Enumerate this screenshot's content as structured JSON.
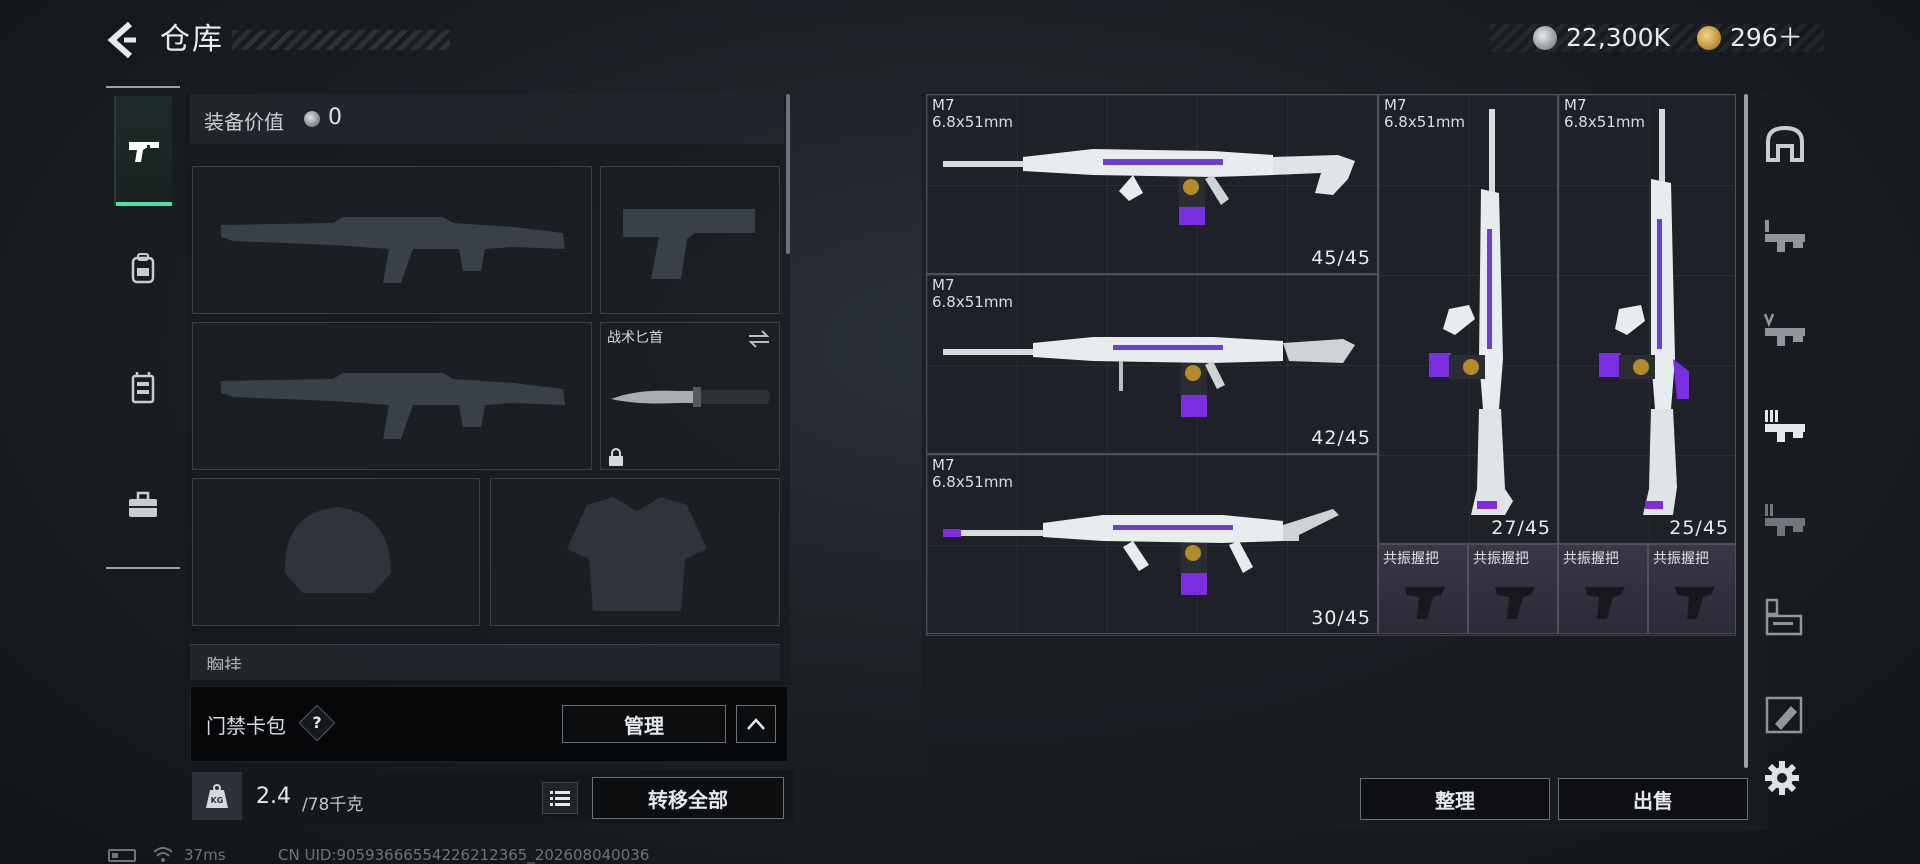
{
  "header": {
    "title": "仓库",
    "currency": [
      {
        "icon": "silver-coin-icon",
        "value": "22,300K"
      },
      {
        "icon": "gold-coin-icon",
        "value": "296＋"
      }
    ]
  },
  "left_tabs": [
    {
      "icon": "pistol-icon",
      "active": true
    },
    {
      "icon": "backpack-icon",
      "active": false
    },
    {
      "icon": "chest-rig-icon",
      "active": false
    },
    {
      "icon": "toolbox-icon",
      "active": false
    }
  ],
  "equipment": {
    "label": "装备价值",
    "value": "0",
    "knife_slot_label": "战术匕首",
    "chest_label": "胸挂"
  },
  "keycard": {
    "label": "门禁卡包",
    "help": "?",
    "manage_label": "管理"
  },
  "weight": {
    "current": "2.4",
    "max": "/78千克",
    "kg_icon": "KG",
    "transfer_all_label": "转移全部"
  },
  "status": {
    "ping": "37ms",
    "uid": "CN UID:9059366655422621236​5_202608040036"
  },
  "storage": {
    "items": [
      {
        "name": "M7",
        "caliber": "6.8x51mm",
        "ammo": "45/45"
      },
      {
        "name": "M7",
        "caliber": "6.8x51mm",
        "ammo": "42/45"
      },
      {
        "name": "M7",
        "caliber": "6.8x51mm",
        "ammo": "30/45"
      },
      {
        "name": "M7",
        "caliber": "6.8x51mm",
        "ammo": "27/45"
      },
      {
        "name": "M7",
        "caliber": "6.8x51mm",
        "ammo": "25/45"
      }
    ],
    "grips": [
      "共振握把",
      "共振握把",
      "共振握把",
      "共振握把"
    ],
    "sort_label": "整理",
    "sell_label": "出售"
  },
  "side_tabs": [
    {
      "icon": "helmet-category-icon"
    },
    {
      "icon": "weapon-category-1-icon"
    },
    {
      "icon": "weapon-category-5-icon"
    },
    {
      "icon": "weapon-category-3-icon"
    },
    {
      "icon": "weapon-category-2-icon"
    },
    {
      "icon": "attachment-category-icon"
    },
    {
      "icon": "ammo-category-icon"
    }
  ],
  "colors": {
    "accent_green": "#4fe0a8",
    "weapon_purple": "#7a2ee0"
  }
}
